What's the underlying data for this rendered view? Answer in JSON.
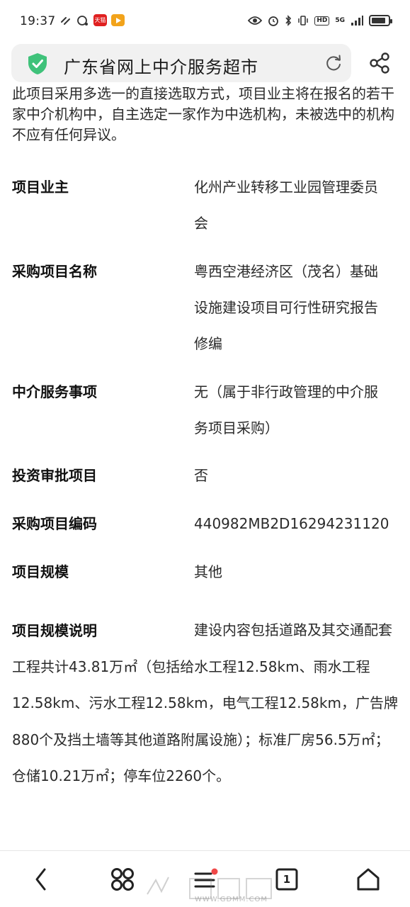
{
  "status_bar": {
    "time": "19:37",
    "app_badge_tmall": "天猫",
    "hd_label": "HD",
    "network_label": "5G",
    "battery_level": 0.85
  },
  "browser": {
    "page_title": "广东省网上中介服务超市"
  },
  "content": {
    "intro_text": "此项目采用多选一的直接选取方式，项目业主将在报名的若干家中介机构中，自主选定一家作为中选机构，未被选中的机构不应有任何异议。",
    "fields": [
      {
        "label": "项目业主",
        "value": "化州产业转移工业园管理委员会"
      },
      {
        "label": "采购项目名称",
        "value": "粤西空港经济区（茂名）基础设施建设项目可行性研究报告修编"
      },
      {
        "label": "中介服务事项",
        "value": "无（属于非行政管理的中介服务项目采购）"
      },
      {
        "label": "投资审批项目",
        "value": "否"
      },
      {
        "label": "采购项目编码",
        "value": "440982MB2D16294231120"
      },
      {
        "label": "项目规模",
        "value": "其他"
      },
      {
        "label": "项目规模说明",
        "value": "建设内容包括道路及其交通配套工程共计43.81万㎡（包括给水工程12.58km、雨水工程12.58km、污水工程12.58km，电气工程12.58km，广告牌880个及挡土墙等其他道路附属设施）；标准厂房56.5万㎡；仓储10.21万㎡；停车位2260个。"
      }
    ]
  },
  "bottom_nav": {
    "tab_count": "1"
  },
  "watermark": {
    "url": "WWW.GDMM.COM"
  },
  "colors": {
    "shield": "#3fc27a",
    "nav_badge": "#f04848"
  }
}
